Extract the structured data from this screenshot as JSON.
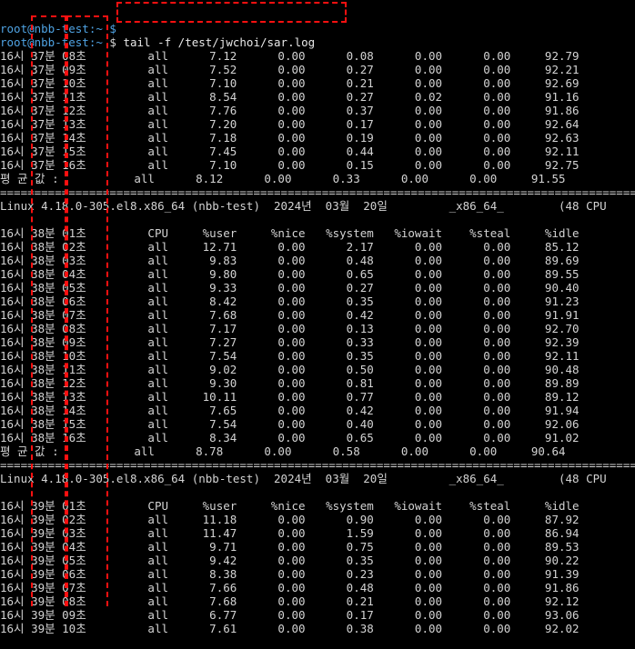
{
  "prompt": {
    "top_partial": "root@nbb-test:~ $ ",
    "user_host": "root@nbb-test:~",
    "symbol": " $ ",
    "command": "tail -f /test/jwchoi/sar.log"
  },
  "section_a": {
    "rows": [
      "16시 37분 08초         all      7.12      0.00      0.08      0.00      0.00     92.79",
      "16시 37분 09초         all      7.52      0.00      0.27      0.00      0.00     92.21",
      "16시 37분 10초         all      7.10      0.00      0.21      0.00      0.00     92.69",
      "16시 37분 11초         all      8.54      0.00      0.27      0.02      0.00     91.16",
      "16시 37분 12초         all      7.76      0.00      0.37      0.00      0.00     91.86",
      "16시 37분 13초         all      7.20      0.00      0.17      0.00      0.00     92.64",
      "16시 37분 14초         all      7.18      0.00      0.19      0.00      0.00     92.63",
      "16시 37분 15초         all      7.45      0.00      0.44      0.00      0.00     92.11",
      "16시 37분 16초         all      7.10      0.00      0.15      0.00      0.00     92.75"
    ],
    "average": "평 균 값 :           all      8.12      0.00      0.33      0.00      0.00     91.55"
  },
  "separator": "================================================================================================",
  "section_b": {
    "linux_header": "Linux 4.18.0-305.el8.x86_64 (nbb-test)  2024년  03월  20일         _x86_64_        (48 CPU",
    "column_header": "16시 38분 01초         CPU     %user     %nice   %system   %iowait    %steal     %idle",
    "rows": [
      "16시 38분 02초         all     12.71      0.00      2.17      0.00      0.00     85.12",
      "16시 38분 03초         all      9.83      0.00      0.48      0.00      0.00     89.69",
      "16시 38분 04초         all      9.80      0.00      0.65      0.00      0.00     89.55",
      "16시 38분 05초         all      9.33      0.00      0.27      0.00      0.00     90.40",
      "16시 38분 06초         all      8.42      0.00      0.35      0.00      0.00     91.23",
      "16시 38분 07초         all      7.68      0.00      0.42      0.00      0.00     91.91",
      "16시 38분 08초         all      7.17      0.00      0.13      0.00      0.00     92.70",
      "16시 38분 09초         all      7.27      0.00      0.33      0.00      0.00     92.39",
      "16시 38분 10초         all      7.54      0.00      0.35      0.00      0.00     92.11",
      "16시 38분 11초         all      9.02      0.00      0.50      0.00      0.00     90.48",
      "16시 38분 12초         all      9.30      0.00      0.81      0.00      0.00     89.89",
      "16시 38분 13초         all     10.11      0.00      0.77      0.00      0.00     89.12",
      "16시 38분 14초         all      7.65      0.00      0.42      0.00      0.00     91.94",
      "16시 38분 15초         all      7.54      0.00      0.40      0.00      0.00     92.06",
      "16시 38분 16초         all      8.34      0.00      0.65      0.00      0.00     91.02"
    ],
    "average": "평 균 값 :           all      8.78      0.00      0.58      0.00      0.00     90.64"
  },
  "section_c": {
    "linux_header": "Linux 4.18.0-305.el8.x86_64 (nbb-test)  2024년  03월  20일         _x86_64_        (48 CPU",
    "column_header": "16시 39분 01초         CPU     %user     %nice   %system   %iowait    %steal     %idle",
    "rows": [
      "16시 39분 02초         all     11.18      0.00      0.90      0.00      0.00     87.92",
      "16시 39분 03초         all     11.47      0.00      1.59      0.00      0.00     86.94",
      "16시 39분 04초         all      9.71      0.00      0.75      0.00      0.00     89.53",
      "16시 39분 05초         all      9.42      0.00      0.35      0.00      0.00     90.22",
      "16시 39분 06초         all      8.38      0.00      0.23      0.00      0.00     91.39",
      "16시 39분 07초         all      7.66      0.00      0.48      0.00      0.00     91.86",
      "16시 39분 08초         all      7.68      0.00      0.21      0.00      0.00     92.12",
      "16시 39분 09초         all      6.77      0.00      0.17      0.00      0.00     93.06",
      "16시 39분 10초         all      7.61      0.00      0.38      0.00      0.00     92.02"
    ]
  },
  "colors": {
    "background": "#000000",
    "text": "#d3d3d3",
    "prompt": "#4fa3e3",
    "highlight": "#ff1010"
  }
}
